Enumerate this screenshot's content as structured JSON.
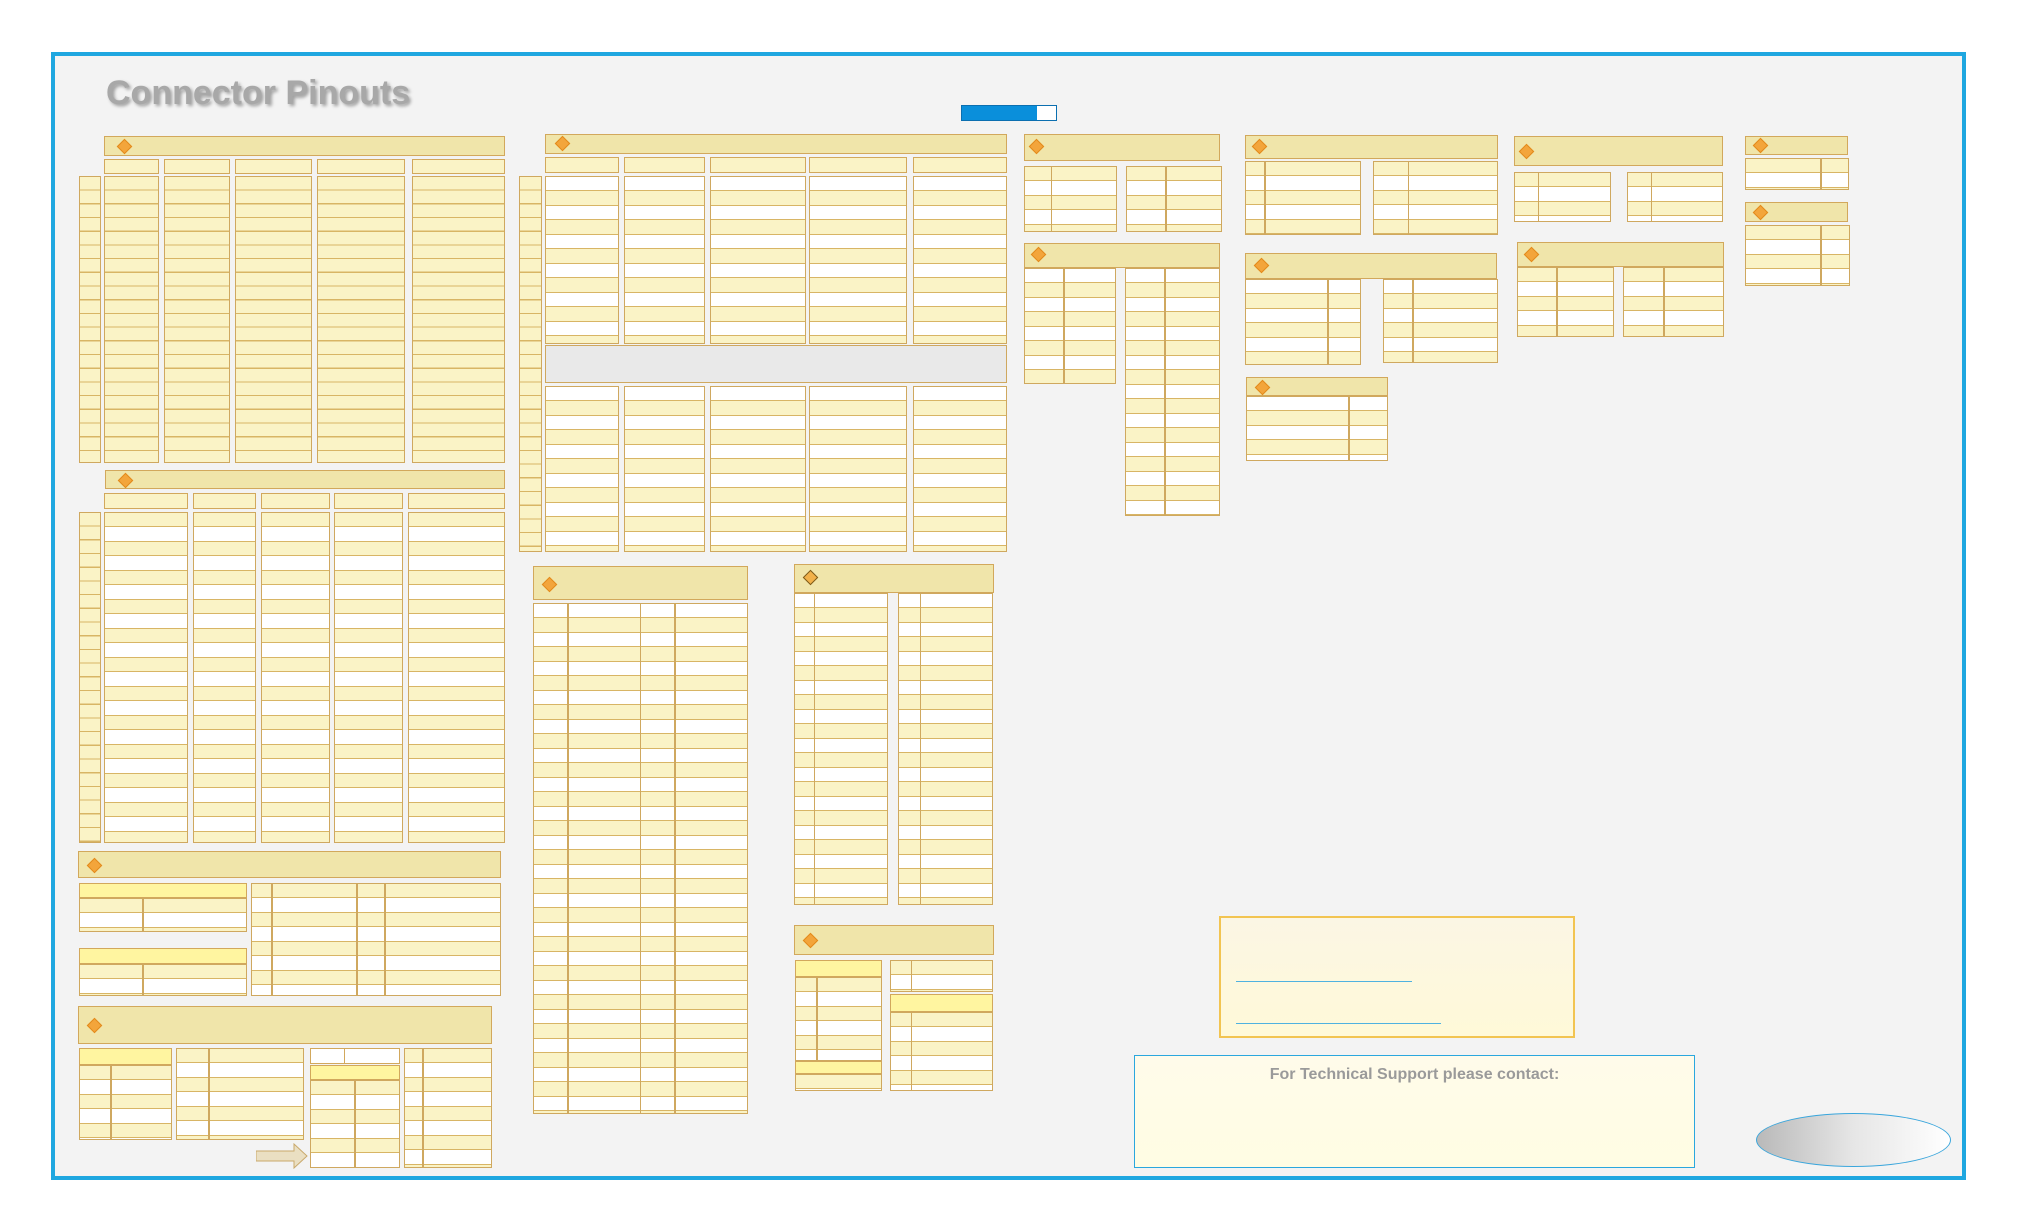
{
  "page": {
    "title": "Connector Pinouts",
    "progress": 0.8
  },
  "panels": [
    {
      "name": "connector-panel-1",
      "label": "",
      "cols": 5,
      "rows": 20
    },
    {
      "name": "connector-panel-2",
      "label": "",
      "cols": 5,
      "rows": 22
    },
    {
      "name": "connector-panel-3",
      "label": "",
      "cols": 5,
      "rows": 23
    },
    {
      "name": "connector-panel-4",
      "label": "",
      "cols": 4,
      "rows": 34
    },
    {
      "name": "connector-panel-5",
      "label": "",
      "cols": 4,
      "rows": 20
    },
    {
      "name": "connector-panel-6",
      "label": "",
      "cols": 4,
      "rows": 4
    },
    {
      "name": "connector-panel-7",
      "label": "",
      "cols": 4,
      "rows": 15
    },
    {
      "name": "connector-panel-8",
      "label": "",
      "cols": 4,
      "rows": 4
    },
    {
      "name": "connector-panel-9",
      "label": "",
      "cols": 4,
      "rows": 5
    },
    {
      "name": "connector-panel-10",
      "label": "",
      "cols": 2,
      "rows": 4
    },
    {
      "name": "connector-panel-11",
      "label": "",
      "cols": 4,
      "rows": 3
    },
    {
      "name": "connector-panel-12",
      "label": "",
      "cols": 4,
      "rows": 4
    },
    {
      "name": "connector-panel-13",
      "label": "",
      "cols": 2,
      "rows": 2
    },
    {
      "name": "connector-panel-14",
      "label": "",
      "cols": 2,
      "rows": 4
    },
    {
      "name": "connector-panel-15",
      "label": "",
      "cols": 4,
      "rows": 8
    },
    {
      "name": "connector-panel-16",
      "label": "",
      "cols": 4,
      "rows": 7
    },
    {
      "name": "connector-panel-17",
      "label": "",
      "cols": 4,
      "rows": 8
    }
  ],
  "info": {
    "links": [
      "",
      ""
    ]
  },
  "support": {
    "text": "For Technical Support please contact:"
  },
  "colors": {
    "frame": "#1fa7e0",
    "header_fill": "#f0e5aa",
    "cell_fill": "#faf3c6",
    "accent": "#f3a53b",
    "progress": "#0a8fdb"
  },
  "icons": [
    "diamond-icon",
    "arrow-right-icon"
  ]
}
